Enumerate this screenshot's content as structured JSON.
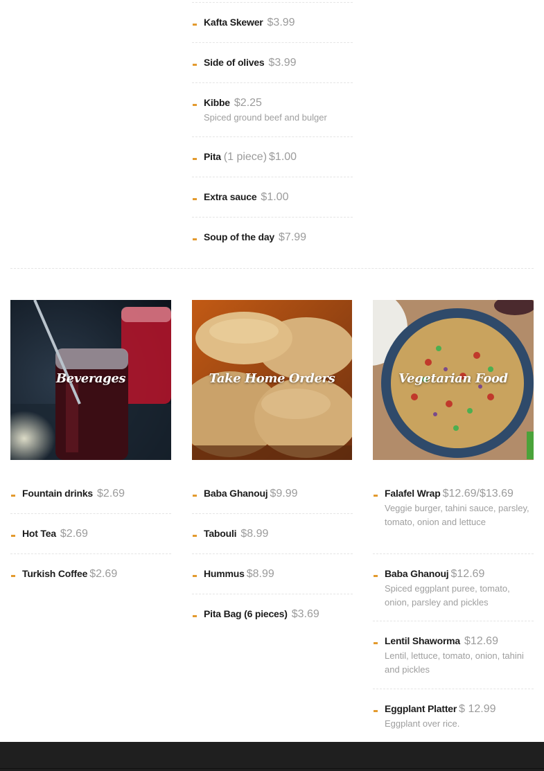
{
  "colors": {
    "accent": "#e39a2e",
    "footer": "#1f1f1f",
    "muted": "#9b9b9b"
  },
  "top_list": [
    {
      "name": "Kafta Skewer",
      "price": "$3.99"
    },
    {
      "name": "Side of olives",
      "price": "$3.99"
    },
    {
      "name": "Kibbe",
      "price": "$2.25",
      "desc": "Spiced ground beef and bulger"
    },
    {
      "name": "Pita",
      "extra": "(1 piece)",
      "price": "$1.00"
    },
    {
      "name": "Extra sauce",
      "price": "$1.00"
    },
    {
      "name": "Soup of the day",
      "price": "$7.99"
    }
  ],
  "cards": [
    {
      "title": "Beverages"
    },
    {
      "title": "Take Home Orders"
    },
    {
      "title": "Vegetarian Food"
    }
  ],
  "beverages": [
    {
      "name": "Fountain drinks",
      "price": "$2.69"
    },
    {
      "name": "Hot Tea",
      "price": "$2.69"
    },
    {
      "name": "Turkish Coffee",
      "price": "$2.69"
    }
  ],
  "take_home": [
    {
      "name": "Baba Ghanouj",
      "price": "$9.99"
    },
    {
      "name": "Tabouli",
      "price": "$8.99"
    },
    {
      "name": "Hummus",
      "price": "$8.99"
    },
    {
      "name": "Pita Bag (6 pieces)",
      "price": "$3.69"
    }
  ],
  "vegetarian": [
    {
      "name": "Falafel Wrap",
      "price": "$12.69/$13.69",
      "desc": "Veggie burger, tahini sauce, parsley, tomato, onion and lettuce"
    },
    {
      "name": "Baba Ghanouj",
      "price": "$12.69",
      "desc": "Spiced eggplant puree, tomato, onion, parsley and pickles"
    },
    {
      "name": "Lentil Shaworma",
      "price": "$12.69",
      "desc": "Lentil, lettuce, tomato, onion, tahini and pickles"
    },
    {
      "name": "Eggplant Platter",
      "price": "$ 12.99",
      "desc": "Eggplant over rice."
    }
  ]
}
